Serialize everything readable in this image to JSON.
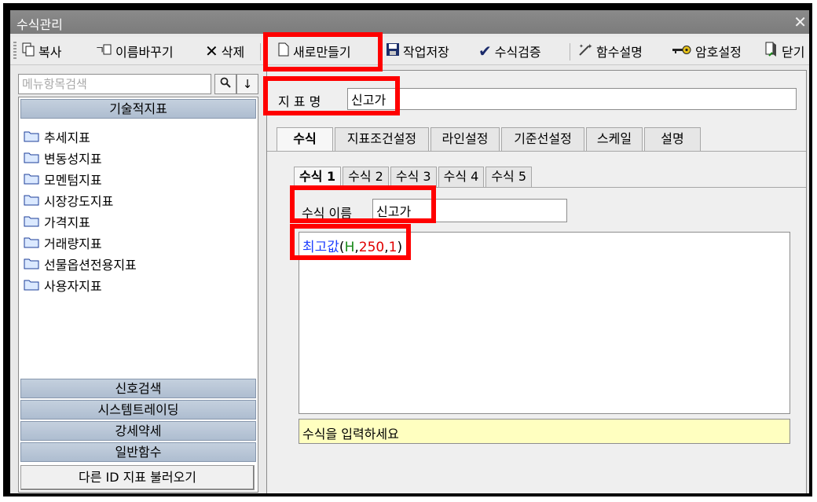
{
  "window": {
    "title": "수식관리",
    "close_glyph": "✕"
  },
  "toolbar": {
    "copy": "복사",
    "rename": "이름바꾸기",
    "delete": "삭제",
    "new": "새로만들기",
    "save": "작업저장",
    "verify": "수식검증",
    "func_desc": "함수설명",
    "password": "암호설정",
    "close": "닫기"
  },
  "left": {
    "search_placeholder": "메뉴항목검색",
    "section_top": "기술적지표",
    "tree": [
      "추세지표",
      "변동성지표",
      "모멘텀지표",
      "시장강도지표",
      "가격지표",
      "거래량지표",
      "선물옵션전용지표",
      "사용자지표"
    ],
    "sections_bottom": [
      "신호검색",
      "시스템트레이딩",
      "강세약세",
      "일반함수"
    ],
    "load_button": "다른 ID 지표 불러오기"
  },
  "right": {
    "indicator_label": "지 표 명",
    "indicator_value": "신고가",
    "tabs": [
      "수식",
      "지표조건설정",
      "라인설정",
      "기준선설정",
      "스케일",
      "설명"
    ],
    "subtabs": [
      "수식 1",
      "수식 2",
      "수식 3",
      "수식 4",
      "수식 5"
    ],
    "formula_name_label": "수식 이름",
    "formula_name_value": "신고가",
    "formula": {
      "func": "최고값",
      "open": "(",
      "arg1": "H",
      "comma1": ",",
      "arg2": "250",
      "comma2": ",",
      "arg3": "1",
      "close": ")"
    },
    "hint": "수식을 입력하세요"
  },
  "colors": {
    "highlight": "#ff0000",
    "func_blue": "#1f3fff",
    "arg_green": "#1a8a1a",
    "num_red": "#e00000",
    "section_blue": "#b7c6d8"
  }
}
